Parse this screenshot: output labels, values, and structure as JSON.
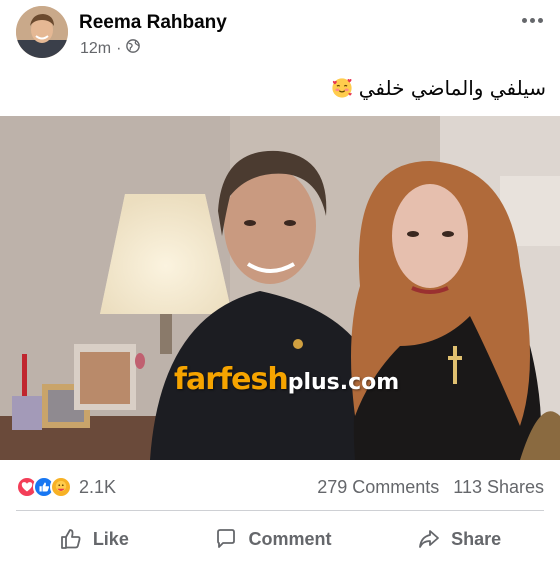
{
  "post": {
    "author": "Reema Rahbany",
    "time": "12m",
    "separator": "·",
    "caption": "سيلفي والماضي خلفي",
    "caption_emoji": "smiling-face-with-hearts"
  },
  "photo": {
    "watermark_brand": "farfesh",
    "watermark_suffix": "plus.com"
  },
  "engagement": {
    "reaction_icons": [
      "love",
      "like",
      "care"
    ],
    "reaction_count": "2.1K",
    "comments": "279 Comments",
    "shares": "113 Shares"
  },
  "actions": {
    "like": "Like",
    "comment": "Comment",
    "share": "Share"
  },
  "colors": {
    "text_primary": "#050505",
    "text_secondary": "#65676b",
    "like_blue": "#1877f2",
    "love_red": "#f33e58",
    "care_yellow": "#f7b125",
    "watermark_orange": "#f6a400"
  }
}
